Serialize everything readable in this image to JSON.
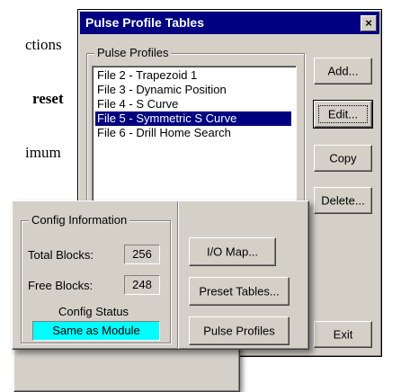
{
  "background_doc": {
    "line1": "ctions",
    "line2": "reset",
    "line3": "imum"
  },
  "dialog": {
    "title": "Pulse Profile Tables",
    "close_glyph": "×",
    "group_label": "Pulse Profiles",
    "list_items": [
      "File 2 - Trapezoid 1",
      "File 3 - Dynamic Position",
      "File 4 - S Curve",
      "File 5 - Symmetric S Curve",
      "File 6 - Drill Home Search"
    ],
    "selected_index": 3,
    "buttons": {
      "add": "Add...",
      "edit": "Edit...",
      "copy": "Copy",
      "delete": "Delete...",
      "exit": "Exit"
    }
  },
  "config": {
    "group_label": "Config Information",
    "total_blocks_label": "Total Blocks:",
    "total_blocks_value": "256",
    "free_blocks_label": "Free Blocks:",
    "free_blocks_value": "248",
    "status_label": "Config Status",
    "status_value": "Same as Module",
    "status_color": "#00ffff",
    "buttons": {
      "io_map": "I/O Map...",
      "preset_tables": "Preset Tables...",
      "pulse_profiles": "Pulse Profiles"
    }
  }
}
